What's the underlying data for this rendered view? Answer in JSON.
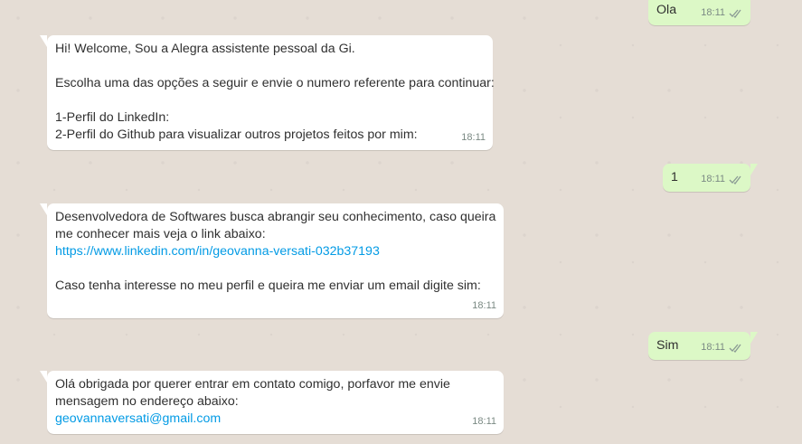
{
  "messages": [
    {
      "text": "Ola",
      "time": "18:11"
    },
    {
      "lines": [
        "Hi! Welcome, Sou a Alegra assistente pessoal da Gi.",
        "",
        "Escolha uma das opções a seguir e envie o numero referente para continuar:",
        "",
        "1-Perfil do LinkedIn:",
        "2-Perfil do Github para visualizar outros projetos feitos por mim:"
      ],
      "time": "18:11"
    },
    {
      "text": "1",
      "time": "18:11"
    },
    {
      "lines": [
        "Desenvolvedora de Softwares busca abrangir seu conhecimento, caso queira",
        "me conhecer mais veja o link abaixo:"
      ],
      "link": "https://www.linkedin.com/in/geovanna-versati-032b37193",
      "lines2": [
        "",
        "Caso tenha interesse no meu perfil e queira me enviar um email digite sim:"
      ],
      "time": "18:11"
    },
    {
      "text": "Sim",
      "time": "18:11"
    },
    {
      "lines": [
        "Olá obrigada por querer entrar em contato comigo, porfavor me envie",
        "mensagem no endereço abaixo:"
      ],
      "link": "geovannaversati@gmail.com",
      "time": "18:11"
    }
  ],
  "colors": {
    "incoming": "#ffffff",
    "outgoing": "#dcf8c6",
    "link": "#039be5",
    "ticks": "#8a9a94"
  }
}
